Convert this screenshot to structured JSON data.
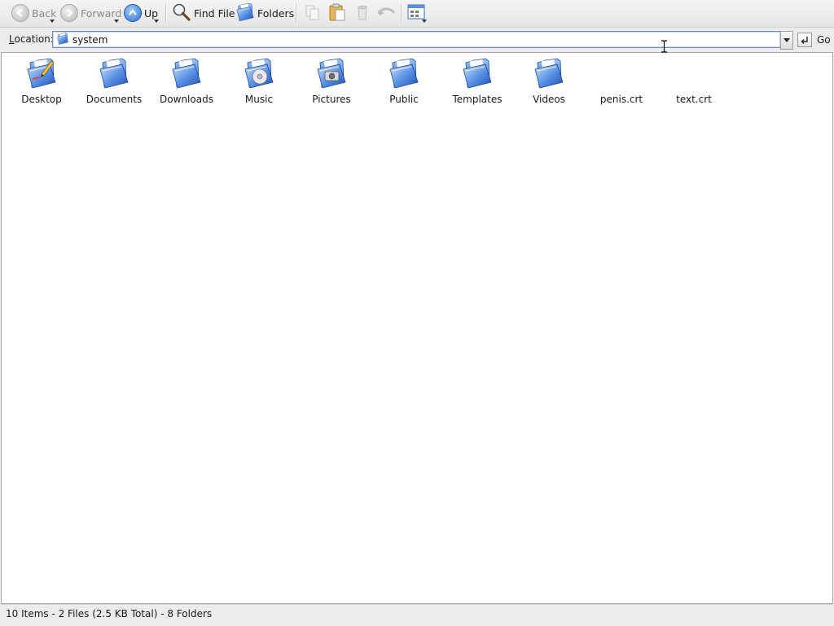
{
  "toolbar": {
    "back_label": "Back",
    "forward_label": "Forward",
    "up_label": "Up",
    "find_file_label": "Find File",
    "folders_label": "Folders",
    "icons": {
      "copy": "copy-icon",
      "paste": "paste-icon",
      "delete": "delete-icon",
      "undo": "undo-icon",
      "view_mode": "view-mode-icon"
    }
  },
  "location": {
    "label": "ocation:",
    "label_accel": "L",
    "value": "system",
    "go_label": "Go"
  },
  "items": [
    {
      "label": "Desktop",
      "icon": "desktop-folder-icon"
    },
    {
      "label": "Documents",
      "icon": "folder-icon"
    },
    {
      "label": "Downloads",
      "icon": "folder-icon"
    },
    {
      "label": "Music",
      "icon": "music-folder-icon"
    },
    {
      "label": "Pictures",
      "icon": "pictures-folder-icon"
    },
    {
      "label": "Public",
      "icon": "folder-icon"
    },
    {
      "label": "Templates",
      "icon": "folder-icon"
    },
    {
      "label": "Videos",
      "icon": "folder-icon"
    },
    {
      "label": "penis.crt",
      "icon": "file-icon"
    },
    {
      "label": "text.crt",
      "icon": "file-icon"
    }
  ],
  "status": {
    "text": "10 Items - 2 Files (2.5 KB Total) - 8 Folders"
  },
  "colors": {
    "accent": "#2c6ed6",
    "folder_blue": "#3f7fe0",
    "content_bg": "#ffffff",
    "chrome_bg": "#ececec"
  }
}
